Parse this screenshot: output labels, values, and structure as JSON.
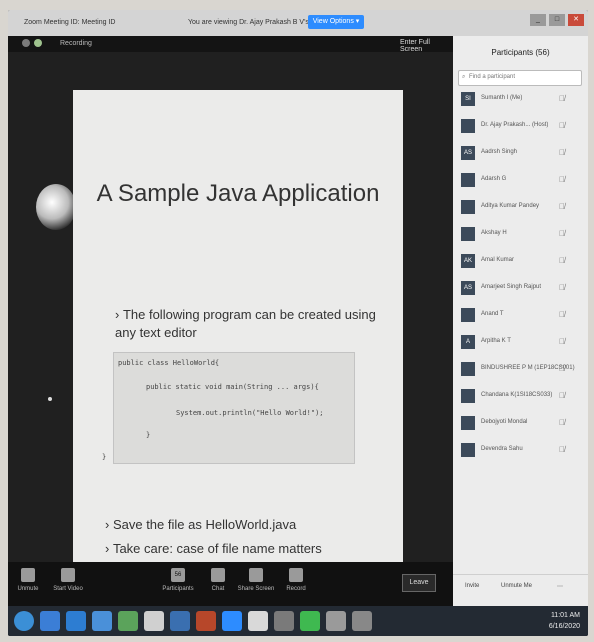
{
  "window": {
    "app_title": "Zoom Meeting ID: Meeting ID",
    "viewing_text": "You are viewing Dr. Ajay Prakash B V's screen",
    "view_options": "View Options ▾"
  },
  "share": {
    "recording": "Recording",
    "enter_fullscreen": "Enter Full Screen"
  },
  "slide": {
    "title": "A Sample Java Application",
    "bullet1": "The following program can be created using any text editor",
    "code": {
      "line1": "public class HelloWorld{",
      "line2": "public static void main(String ... args){",
      "line3": "System.out.println(\"Hello World!\");",
      "line4": "}",
      "line5": "}"
    },
    "bullet2": "Save the file as HelloWorld.java",
    "bullet3": "Take care: case of file name matters"
  },
  "participants": {
    "title": "Participants (56)",
    "search_placeholder": "Find a participant",
    "search_icon": "search-icon",
    "list": [
      {
        "initials": "SI",
        "name": "Sumanth I (Me)"
      },
      {
        "initials": "",
        "name": "Dr. Ajay Prakash... (Host)"
      },
      {
        "initials": "AS",
        "name": "Aadrsh Singh"
      },
      {
        "initials": "",
        "name": "Adarsh G"
      },
      {
        "initials": "",
        "name": "Aditya Kumar Pandey"
      },
      {
        "initials": "",
        "name": "Akshay H"
      },
      {
        "initials": "AK",
        "name": "Amal Kumar"
      },
      {
        "initials": "AS",
        "name": "Amarjeet Singh Rajput"
      },
      {
        "initials": "",
        "name": "Anand T"
      },
      {
        "initials": "A",
        "name": "Arpitha K T"
      },
      {
        "initials": "",
        "name": "BINDUSHREE P M (1EP18CS001)"
      },
      {
        "initials": "",
        "name": "Chandana K(1SI18CS033)"
      },
      {
        "initials": "",
        "name": "Debojyoti Mondal"
      },
      {
        "initials": "",
        "name": "Devendra Sahu"
      }
    ],
    "invite": "Invite",
    "unmute_me": "Unmute Me"
  },
  "toolbar": {
    "unmute": "Unmute",
    "start_video": "Start Video",
    "participants": "Participants",
    "participants_count": "56",
    "chat": "Chat",
    "share_screen": "Share Screen",
    "record": "Record",
    "leave": "Leave"
  },
  "taskbar": {
    "time": "11:01 AM",
    "date": "6/16/2020"
  },
  "colors": {
    "accent": "#2d8cff",
    "taskbar": "#232a33"
  }
}
